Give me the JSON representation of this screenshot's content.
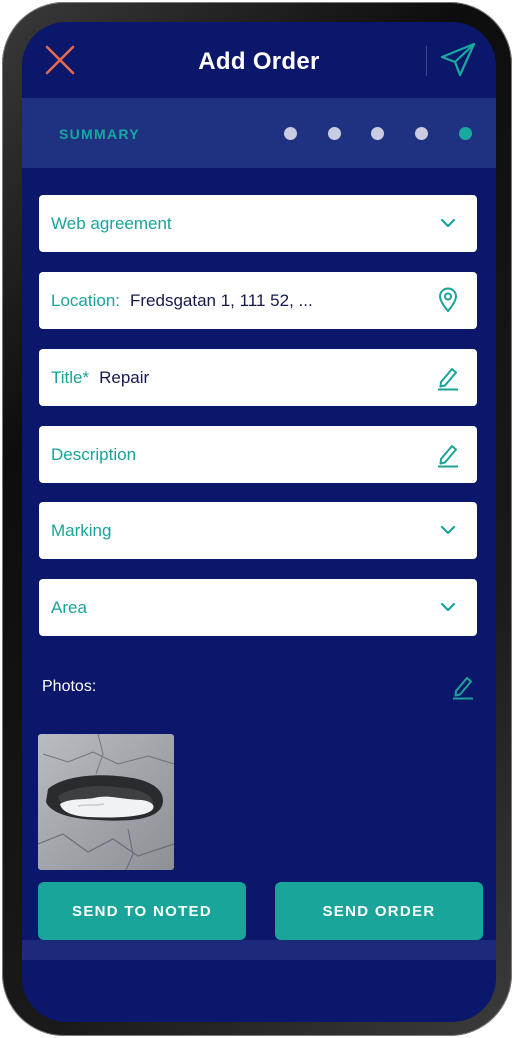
{
  "header": {
    "title": "Add Order",
    "close_icon": "close-icon",
    "send_icon": "paper-plane-icon"
  },
  "stepper": {
    "label": "SUMMARY",
    "steps_total": 5,
    "active_step": 5
  },
  "fields": {
    "agreement": {
      "label": "Web agreement",
      "icon": "chevron-down-icon"
    },
    "location": {
      "label": "Location:",
      "value": "Fredsgatan 1, 111 52, ...",
      "icon": "map-pin-icon"
    },
    "title": {
      "label": "Title*",
      "value": "Repair",
      "icon": "pencil-icon"
    },
    "description": {
      "label": "Description",
      "icon": "pencil-icon"
    },
    "marking": {
      "label": "Marking",
      "icon": "chevron-down-icon"
    },
    "area": {
      "label": "Area",
      "icon": "chevron-down-icon"
    }
  },
  "photos": {
    "label": "Photos:",
    "edit_icon": "pencil-icon",
    "items": [
      {
        "name": "pothole-photo"
      }
    ]
  },
  "actions": {
    "send_to_noted": "SEND TO NOTED",
    "send_order": "SEND ORDER"
  },
  "colors": {
    "background": "#0b176b",
    "stepper_bg": "#1f3181",
    "accent": "#1aa59a",
    "close": "#e9694f",
    "dot_inactive": "#c9cce0"
  }
}
